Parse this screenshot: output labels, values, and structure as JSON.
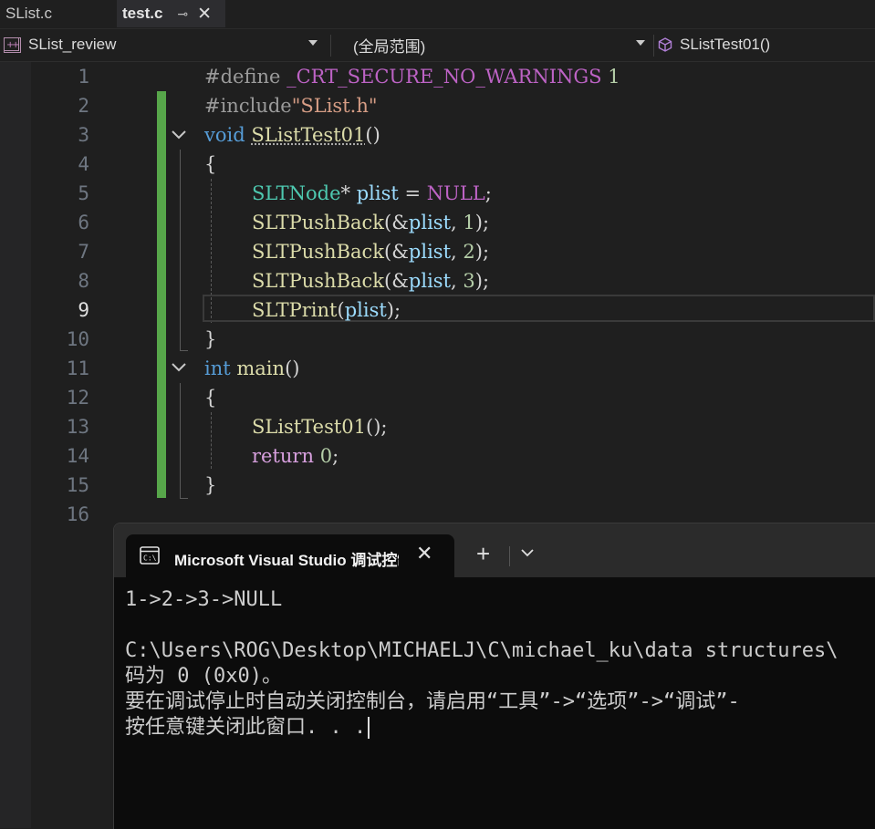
{
  "tabs": [
    {
      "label": "SList.c",
      "active": false
    },
    {
      "label": "test.c",
      "active": true,
      "pin_glyph": "⊸",
      "close_glyph": "✕"
    }
  ],
  "nav": {
    "project": "SList_review",
    "scope": "(全局范围)",
    "member": "SListTest01()"
  },
  "editor": {
    "line_numbers": [
      "1",
      "2",
      "3",
      "4",
      "5",
      "6",
      "7",
      "8",
      "9",
      "10",
      "11",
      "12",
      "13",
      "14",
      "15",
      "16"
    ],
    "current_line": 9,
    "lines": {
      "l1_directive": "#define ",
      "l1_macro": "_CRT_SECURE_NO_WARNINGS",
      "l1_value": " 1",
      "l2_directive": "#include",
      "l2_header": "\"SList.h\"",
      "l3_kw": "void",
      "l3_fn": "SListTest01",
      "l3_paren": "()",
      "l4": "{",
      "l5_type": "SLTNode",
      "l5_star": "* ",
      "l5_var": "plist",
      "l5_eq": " = ",
      "l5_null": "NULL",
      "l5_end": ";",
      "l6_fn": "SLTPushBack",
      "l6_a": "(&",
      "l6_var": "plist",
      "l6_b": ", ",
      "l6_num": "1",
      "l6_c": ");",
      "l7_fn": "SLTPushBack",
      "l7_a": "(&",
      "l7_var": "plist",
      "l7_b": ", ",
      "l7_num": "2",
      "l7_c": ");",
      "l8_fn": "SLTPushBack",
      "l8_a": "(&",
      "l8_var": "plist",
      "l8_b": ", ",
      "l8_num": "3",
      "l8_c": ");",
      "l9_fn": "SLTPrint",
      "l9_a": "(",
      "l9_var": "plist",
      "l9_c": ");",
      "l10": "}",
      "l11_kw": "int",
      "l11_fn": "main",
      "l11_paren": "()",
      "l12": "{",
      "l13_fn": "SListTest01",
      "l13_end": "();",
      "l14_kw": "return",
      "l14_sp": " ",
      "l14_num": "0",
      "l14_end": ";",
      "l15": "}"
    }
  },
  "terminal": {
    "tab_title": "Microsoft Visual Studio 调试控制台",
    "close_glyph": "✕",
    "new_tab_glyph": "+",
    "output": [
      "1->2->3->NULL",
      "",
      "C:\\Users\\ROG\\Desktop\\MICHAELJ\\C\\michael_ku\\data structures\\",
      "码为 0 (0x0)。",
      "要在调试停止时自动关闭控制台，请启用“工具”->“选项”->“调试”-",
      "按任意键关闭此窗口. . ."
    ]
  },
  "colors": {
    "background": "#1f1f1f",
    "keyword": "#569cd6",
    "function": "#dcdcaa",
    "type": "#4ec9b0",
    "variable": "#9cdcfe",
    "string": "#d69d85",
    "macro": "#bd63c5",
    "change_bar": "#57a64a"
  }
}
